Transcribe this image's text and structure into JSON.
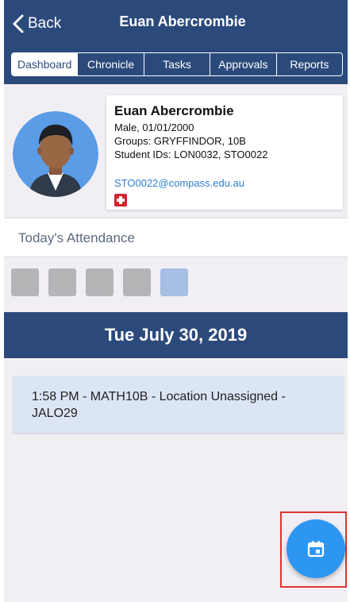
{
  "header": {
    "back_label": "Back",
    "title": "Euan Abercrombie"
  },
  "tabs": [
    {
      "label": "Dashboard",
      "active": true
    },
    {
      "label": "Chronicle",
      "active": false
    },
    {
      "label": "Tasks",
      "active": false
    },
    {
      "label": "Approvals",
      "active": false
    },
    {
      "label": "Reports",
      "active": false
    }
  ],
  "profile": {
    "name": "Euan Abercrombie",
    "gender_dob": "Male, 01/01/2000",
    "groups": "Groups: GRYFFINDOR, 10B",
    "student_ids": "Student IDs: LON0032, STO0022",
    "email": "STO0022@compass.edu.au",
    "medical_icon": "medical-alert-icon"
  },
  "attendance": {
    "title": "Today's Attendance",
    "boxes": [
      {
        "color": "#b5b5b8"
      },
      {
        "color": "#b5b5b8"
      },
      {
        "color": "#b5b5b8"
      },
      {
        "color": "#b5b5b8"
      },
      {
        "color": "#a6bfe3"
      }
    ]
  },
  "date_bar": {
    "date": "Tue July 30, 2019"
  },
  "events": [
    {
      "text": "1:58 PM - MATH10B - Location Unassigned - JALO29"
    }
  ],
  "fab": {
    "icon": "calendar-icon"
  },
  "colors": {
    "navbar": "#2b4a7b",
    "fab": "#2d96f0",
    "event_bg": "#dce5f5",
    "highlight": "#e0342f"
  }
}
